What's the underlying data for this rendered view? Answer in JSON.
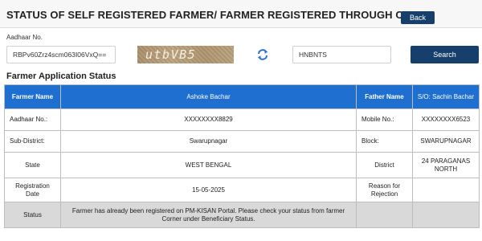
{
  "page": {
    "title": "STATUS OF SELF REGISTERED FARMER/ FARMER REGISTERED THROUGH CSC",
    "back_label": "Back"
  },
  "form": {
    "aadhaar_label": "Aadhaar No.",
    "aadhaar_value": "RBPv60Zrz4scm063I06VxQ==",
    "captcha_text": "utbVB5",
    "captcha_input_value": "HNBNTS",
    "refresh_icon": "refresh-icon",
    "search_label": "Search"
  },
  "section": {
    "title": "Farmer Application Status"
  },
  "colors": {
    "header_blue": "#1f6fd0",
    "button_navy": "#163f6b",
    "status_row_gray": "#d9d9d9"
  },
  "table": {
    "header": {
      "farmer_name_label": "Farmer Name",
      "farmer_name_value": "Ashoke Bachar",
      "father_name_label": "Father Name",
      "father_name_value": "S/O: Sachin Bachar"
    },
    "rows": [
      {
        "left_label": "Aadhaar No.:",
        "left_value": "XXXXXXXX8829",
        "right_label": "Mobile No.:",
        "right_value": "XXXXXXXX6523"
      },
      {
        "left_label": "Sub-District:",
        "left_value": "Swarupnagar",
        "right_label": "Block:",
        "right_value": "SWARUPNAGAR"
      },
      {
        "left_label": "State",
        "left_value": "WEST BENGAL",
        "right_label": "District",
        "right_value": "24 PARAGANAS NORTH"
      },
      {
        "left_label": "Registration Date",
        "left_value": "15-05-2025",
        "right_label": "Reason for Rejection",
        "right_value": ""
      }
    ],
    "status": {
      "label": "Status",
      "message": "Farmer has already been registered on PM-KISAN Portal. Please check your status from farmer Corner under Beneficiary Status."
    }
  }
}
